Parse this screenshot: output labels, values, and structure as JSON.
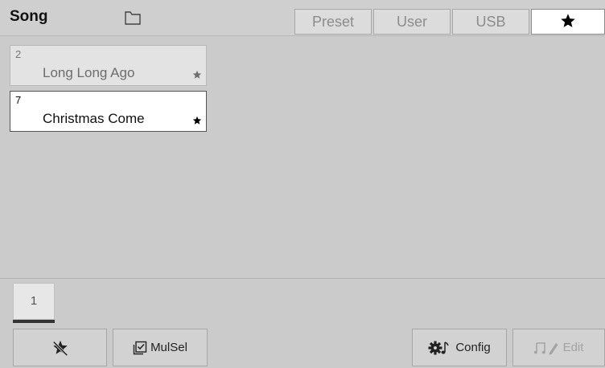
{
  "header": {
    "title": "Song",
    "folder_icon": "folder-icon",
    "tabs": [
      {
        "label": "Preset",
        "active": false
      },
      {
        "label": "User",
        "active": false
      },
      {
        "label": "USB",
        "active": false
      },
      {
        "label": "",
        "icon": "star-icon",
        "active": true
      }
    ]
  },
  "songs": [
    {
      "number": "2",
      "name": "Long Long Ago",
      "favorite": true,
      "selected": false
    },
    {
      "number": "7",
      "name": "Christmas Come",
      "favorite": true,
      "selected": true
    }
  ],
  "pagination": {
    "current_page": "1"
  },
  "toolbar": {
    "unfavorite_icon": "star-crossed-icon",
    "mulsel_label": "MulSel",
    "mulsel_icon": "multi-select-icon",
    "config_label": "Config",
    "config_icon": "gear-note-icon",
    "edit_label": "Edit",
    "edit_icon": "music-pencil-icon",
    "edit_enabled": false
  },
  "colors": {
    "background": "#cbcbcb",
    "selected_card": "#ffffff",
    "card": "#e3e3e3",
    "active_tab": "#ffffff",
    "tab": "#dcdcdc"
  }
}
